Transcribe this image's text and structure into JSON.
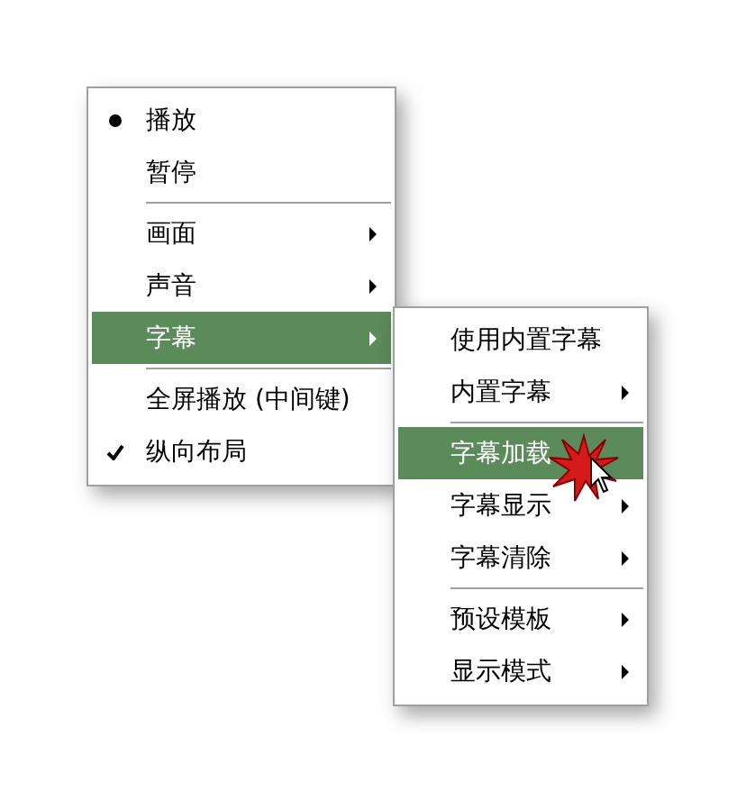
{
  "menu": {
    "items": [
      {
        "kind": "radio",
        "label": "播放",
        "checked": true,
        "submenu": false,
        "selected": false
      },
      {
        "kind": "radio",
        "label": "暂停",
        "checked": false,
        "submenu": false,
        "selected": false
      },
      {
        "kind": "separator"
      },
      {
        "kind": "item",
        "label": "画面",
        "submenu": true,
        "selected": false
      },
      {
        "kind": "item",
        "label": "声音",
        "submenu": true,
        "selected": false
      },
      {
        "kind": "item",
        "label": "字幕",
        "submenu": true,
        "selected": true
      },
      {
        "kind": "separator"
      },
      {
        "kind": "item",
        "label": "全屏播放 (中间键)",
        "submenu": false,
        "selected": false
      },
      {
        "kind": "check",
        "label": "纵向布局",
        "checked": true,
        "submenu": false,
        "selected": false
      }
    ]
  },
  "submenu": {
    "items": [
      {
        "kind": "item",
        "label": "使用内置字幕",
        "submenu": false,
        "selected": false
      },
      {
        "kind": "item",
        "label": "内置字幕",
        "submenu": true,
        "selected": false
      },
      {
        "kind": "separator"
      },
      {
        "kind": "item",
        "label": "字幕加载",
        "submenu": false,
        "selected": true
      },
      {
        "kind": "item",
        "label": "字幕显示",
        "submenu": true,
        "selected": false
      },
      {
        "kind": "item",
        "label": "字幕清除",
        "submenu": true,
        "selected": false
      },
      {
        "kind": "separator"
      },
      {
        "kind": "item",
        "label": "预设模板",
        "submenu": true,
        "selected": false
      },
      {
        "kind": "item",
        "label": "显示模式",
        "submenu": true,
        "selected": false
      }
    ]
  }
}
